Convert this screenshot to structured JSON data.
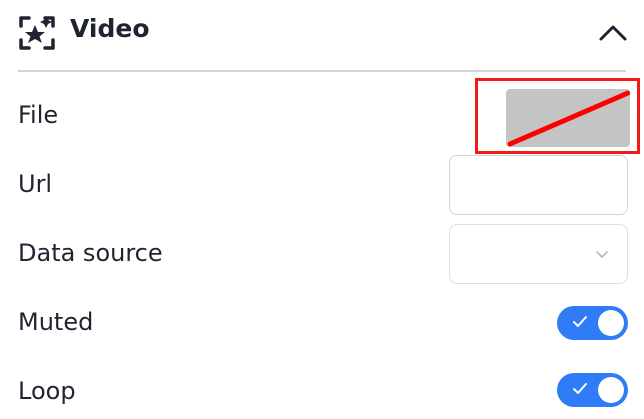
{
  "panel": {
    "title": "Video",
    "icon": "sparkle-frame-icon",
    "expanded": true,
    "collapse_icon": "chevron-up-icon"
  },
  "fields": {
    "file": {
      "label": "File",
      "preview_icon": "empty-file-preview-icon",
      "highlight_color": "#ef1b1b"
    },
    "url": {
      "label": "Url",
      "value": ""
    },
    "data_source": {
      "label": "Data source",
      "selected": "",
      "icon": "chevron-down-icon"
    },
    "muted": {
      "label": "Muted",
      "enabled": true,
      "icon": "checkmark-icon"
    },
    "loop": {
      "label": "Loop",
      "enabled": true,
      "icon": "checkmark-icon"
    }
  },
  "colors": {
    "text": "#1f2430",
    "divider": "#d6d6d6",
    "toggle_on": "#2f7cf6",
    "preview_gray": "#c4c4c4",
    "preview_slash": "#ff0000"
  }
}
